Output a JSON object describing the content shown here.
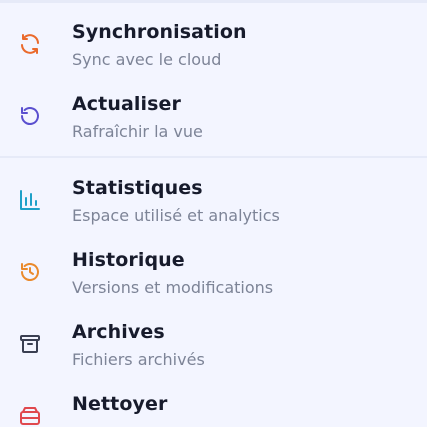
{
  "menu": {
    "sync": {
      "label": "Synchronisation",
      "description": "Sync avec le cloud",
      "icon": "sync-icon",
      "color": "#ea6a2c"
    },
    "refresh": {
      "label": "Actualiser",
      "description": "Rafraîchir la vue",
      "icon": "refresh-icon",
      "color": "#5a4fcf"
    },
    "stats": {
      "label": "Statistiques",
      "description": "Espace utilisé et analytics",
      "icon": "bar-chart-icon",
      "color": "#1ea0c8"
    },
    "history": {
      "label": "Historique",
      "description": "Versions et modifications",
      "icon": "history-icon",
      "color": "#ea8a2c"
    },
    "archives": {
      "label": "Archives",
      "description": "Fichiers archivés",
      "icon": "archive-icon",
      "color": "#3a3f52"
    },
    "cleanup": {
      "label": "Nettoyer",
      "description": "",
      "icon": "drive-icon",
      "color": "#e0484e"
    }
  }
}
